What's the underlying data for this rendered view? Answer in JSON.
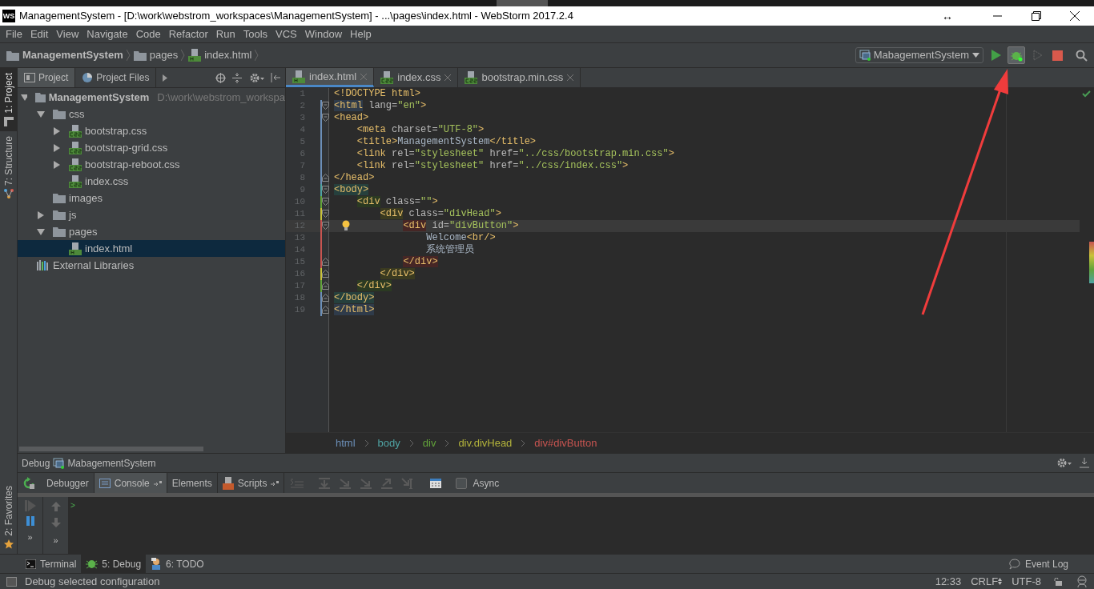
{
  "window": {
    "title": "ManagementSystem - [D:\\work\\webstrom_workspaces\\ManagementSystem] - ...\\pages\\index.html - WebStorm 2017.2.4",
    "app_icon": "WS",
    "resize_glyph": "↔"
  },
  "menu": [
    {
      "label": "File"
    },
    {
      "label": "Edit"
    },
    {
      "label": "View"
    },
    {
      "label": "Navigate"
    },
    {
      "label": "Code"
    },
    {
      "label": "Refactor"
    },
    {
      "label": "Run"
    },
    {
      "label": "Tools"
    },
    {
      "label": "VCS"
    },
    {
      "label": "Window"
    },
    {
      "label": "Help"
    }
  ],
  "navbar": {
    "breadcrumbs": [
      {
        "label": "ManagementSystem",
        "kind": "project"
      },
      {
        "label": "pages",
        "kind": "folder"
      },
      {
        "label": "index.html",
        "kind": "html"
      }
    ],
    "run_config": "MabagementSystem",
    "debug_highlighted": true
  },
  "side_tools": [
    {
      "label": "1: Project",
      "selected": true,
      "kind": "project"
    },
    {
      "label": "7: Structure",
      "selected": false,
      "kind": "structure"
    }
  ],
  "side_tools_bottom": [
    {
      "label": "2: Favorites",
      "selected": false,
      "kind": "favorites"
    }
  ],
  "project_panel": {
    "tabs": [
      {
        "label": "Project",
        "selected": true,
        "kind": "project"
      },
      {
        "label": "Project Files",
        "selected": false,
        "kind": "files"
      }
    ],
    "tree": [
      {
        "label": "ManagementSystem",
        "kind": "project",
        "path": "D:\\work\\webstrom_workspa",
        "expanded": true,
        "selected": false,
        "children": [
          {
            "label": "css",
            "kind": "folder",
            "expanded": true,
            "selected": false,
            "children": [
              {
                "label": "bootstrap.css",
                "kind": "css",
                "expandable": true,
                "selected": false
              },
              {
                "label": "bootstrap-grid.css",
                "kind": "css",
                "expandable": true,
                "selected": false
              },
              {
                "label": "bootstrap-reboot.css",
                "kind": "css",
                "expandable": true,
                "selected": false
              },
              {
                "label": "index.css",
                "kind": "css",
                "expandable": false,
                "selected": false
              }
            ]
          },
          {
            "label": "images",
            "kind": "folder",
            "expandable": false,
            "selected": false
          },
          {
            "label": "js",
            "kind": "folder",
            "expandable": true,
            "expanded": false,
            "selected": false
          },
          {
            "label": "pages",
            "kind": "folder",
            "expanded": true,
            "selected": false,
            "children": [
              {
                "label": "index.html",
                "kind": "html",
                "expandable": false,
                "selected": true
              }
            ]
          }
        ]
      },
      {
        "label": "External Libraries",
        "kind": "libraries",
        "expandable": false,
        "selected": false
      }
    ]
  },
  "editor": {
    "tabs": [
      {
        "label": "index.html",
        "kind": "html",
        "selected": true
      },
      {
        "label": "index.css",
        "kind": "css",
        "selected": false
      },
      {
        "label": "bootstrap.min.css",
        "kind": "css",
        "selected": false
      }
    ],
    "lines": [
      {
        "number": "1",
        "kind": "plain",
        "tokens": [
          {
            "text": "<!DOCTYPE html>",
            "kind": "tag"
          }
        ]
      },
      {
        "number": "2",
        "kind": "fold-start",
        "color": "#6c8fb8",
        "tokens": [
          {
            "text": "<html",
            "kind": "tag",
            "color": "#2f3b4a"
          },
          {
            "text": " lang=",
            "kind": "attr"
          },
          {
            "text": "\"en\"",
            "kind": "value"
          },
          {
            "text": ">",
            "kind": "tag"
          }
        ]
      },
      {
        "number": "3",
        "kind": "fold-start",
        "color": "#6c8fb8",
        "tokens": [
          {
            "text": "<head>",
            "kind": "tag"
          }
        ]
      },
      {
        "number": "4",
        "kind": "plain",
        "color": "#6c8fb8",
        "tokens": [
          {
            "text": "    <meta",
            "kind": "tag"
          },
          {
            "text": " charset=",
            "kind": "attr"
          },
          {
            "text": "\"UTF-8\"",
            "kind": "value"
          },
          {
            "text": ">",
            "kind": "tag"
          }
        ]
      },
      {
        "number": "5",
        "kind": "plain",
        "color": "#6c8fb8",
        "tokens": [
          {
            "text": "    <title>",
            "kind": "tag"
          },
          {
            "text": "ManagementSystem",
            "kind": "text"
          },
          {
            "text": "</title>",
            "kind": "tag"
          }
        ]
      },
      {
        "number": "6",
        "kind": "plain",
        "color": "#6c8fb8",
        "tokens": [
          {
            "text": "    <link",
            "kind": "tag"
          },
          {
            "text": " rel=",
            "kind": "attr"
          },
          {
            "text": "\"stylesheet\"",
            "kind": "value"
          },
          {
            "text": " href=",
            "kind": "attr"
          },
          {
            "text": "\"../css/bootstrap.min.css\"",
            "kind": "value"
          },
          {
            "text": ">",
            "kind": "tag"
          }
        ]
      },
      {
        "number": "7",
        "kind": "plain",
        "color": "#6c8fb8",
        "tokens": [
          {
            "text": "    <link",
            "kind": "tag"
          },
          {
            "text": " rel=",
            "kind": "attr"
          },
          {
            "text": "\"stylesheet\"",
            "kind": "value"
          },
          {
            "text": " href=",
            "kind": "attr"
          },
          {
            "text": "\"../css/index.css\"",
            "kind": "value"
          },
          {
            "text": ">",
            "kind": "tag"
          }
        ]
      },
      {
        "number": "8",
        "kind": "fold-end",
        "color": "#6c8fb8",
        "tokens": [
          {
            "text": "</head>",
            "kind": "tag"
          }
        ]
      },
      {
        "number": "9",
        "kind": "fold-start",
        "color": "#4fa3a3",
        "tokens": [
          {
            "text": "<body>",
            "kind": "tag",
            "color": "#26403d"
          }
        ]
      },
      {
        "number": "10",
        "kind": "fold-start",
        "color": "#62a33a",
        "tokens": [
          {
            "text": "    <div",
            "kind": "tag",
            "color": "#2b3a22"
          },
          {
            "text": " class=",
            "kind": "attr"
          },
          {
            "text": "\"\"",
            "kind": "value"
          },
          {
            "text": ">",
            "kind": "tag"
          }
        ]
      },
      {
        "number": "11",
        "kind": "fold-start",
        "color": "#c8c23a",
        "tokens": [
          {
            "text": "        <div",
            "kind": "tag",
            "color": "#3a3a20"
          },
          {
            "text": " class=",
            "kind": "attr"
          },
          {
            "text": "\"divHead\"",
            "kind": "value"
          },
          {
            "text": ">",
            "kind": "tag"
          }
        ]
      },
      {
        "number": "12",
        "kind": "fold-start",
        "color": "#c75450",
        "current": true,
        "bulb": true,
        "tokens": [
          {
            "text": "            <div",
            "kind": "tag",
            "color": "#462625"
          },
          {
            "text": " id=",
            "kind": "attr"
          },
          {
            "text": "\"divButton\"",
            "kind": "value"
          },
          {
            "text": ">",
            "kind": "tag"
          }
        ]
      },
      {
        "number": "13",
        "kind": "plain",
        "color": "#c75450",
        "tokens": [
          {
            "text": "                Welcome",
            "kind": "text"
          },
          {
            "text": "<br/>",
            "kind": "tag"
          }
        ]
      },
      {
        "number": "14",
        "kind": "plain",
        "color": "#c75450",
        "tokens": [
          {
            "text": "                系统管理员",
            "kind": "text"
          }
        ]
      },
      {
        "number": "15",
        "kind": "fold-end",
        "color": "#c75450",
        "tokens": [
          {
            "text": "            </div>",
            "kind": "tag",
            "color": "#462625"
          }
        ]
      },
      {
        "number": "16",
        "kind": "fold-end",
        "color": "#c8c23a",
        "tokens": [
          {
            "text": "        </div>",
            "kind": "tag",
            "color": "#3a3a20"
          }
        ]
      },
      {
        "number": "17",
        "kind": "fold-end",
        "color": "#62a33a",
        "tokens": [
          {
            "text": "    </div>",
            "kind": "tag",
            "color": "#2b3a22"
          }
        ]
      },
      {
        "number": "18",
        "kind": "fold-end",
        "color": "#6c8fb8",
        "tokens": [
          {
            "text": "</body>",
            "kind": "tag",
            "color": "#26403d"
          }
        ]
      },
      {
        "number": "19",
        "kind": "fold-end",
        "color": "#6c8fb8",
        "tokens": [
          {
            "text": "</html>",
            "kind": "tag",
            "color": "#2f3b4a"
          }
        ]
      }
    ],
    "breadcrumbs": [
      {
        "label": "html",
        "color": "#6c8fb8"
      },
      {
        "label": "body",
        "color": "#4fa3a3"
      },
      {
        "label": "div",
        "color": "#62a33a"
      },
      {
        "label": "div.divHead",
        "color": "#b3b33b"
      },
      {
        "label": "div#divButton",
        "color": "#c75450"
      }
    ]
  },
  "debug_panel": {
    "title": "Debug",
    "config": "MabagementSystem",
    "tabs": [
      {
        "label": "Debugger",
        "selected": false,
        "kind": "plain"
      },
      {
        "label": "Console",
        "selected": true,
        "kind": "console"
      },
      {
        "label": "Elements",
        "selected": false,
        "kind": "plain"
      },
      {
        "label": "Scripts",
        "selected": false,
        "kind": "scripts"
      }
    ],
    "async": {
      "label": "Async",
      "checked": false
    },
    "prompt": ">",
    "more": [
      "»",
      "»"
    ]
  },
  "tool_tabs": [
    {
      "label": "Terminal",
      "kind": "terminal",
      "selected": false
    },
    {
      "label": "5: Debug",
      "kind": "debug",
      "selected": true
    },
    {
      "label": "6: TODO",
      "kind": "todo",
      "selected": false
    }
  ],
  "event_log": "Event Log",
  "status_bar": {
    "message": "Debug selected configuration",
    "time": "12:33",
    "line_separator": "CRLF",
    "encoding": "UTF-8"
  }
}
